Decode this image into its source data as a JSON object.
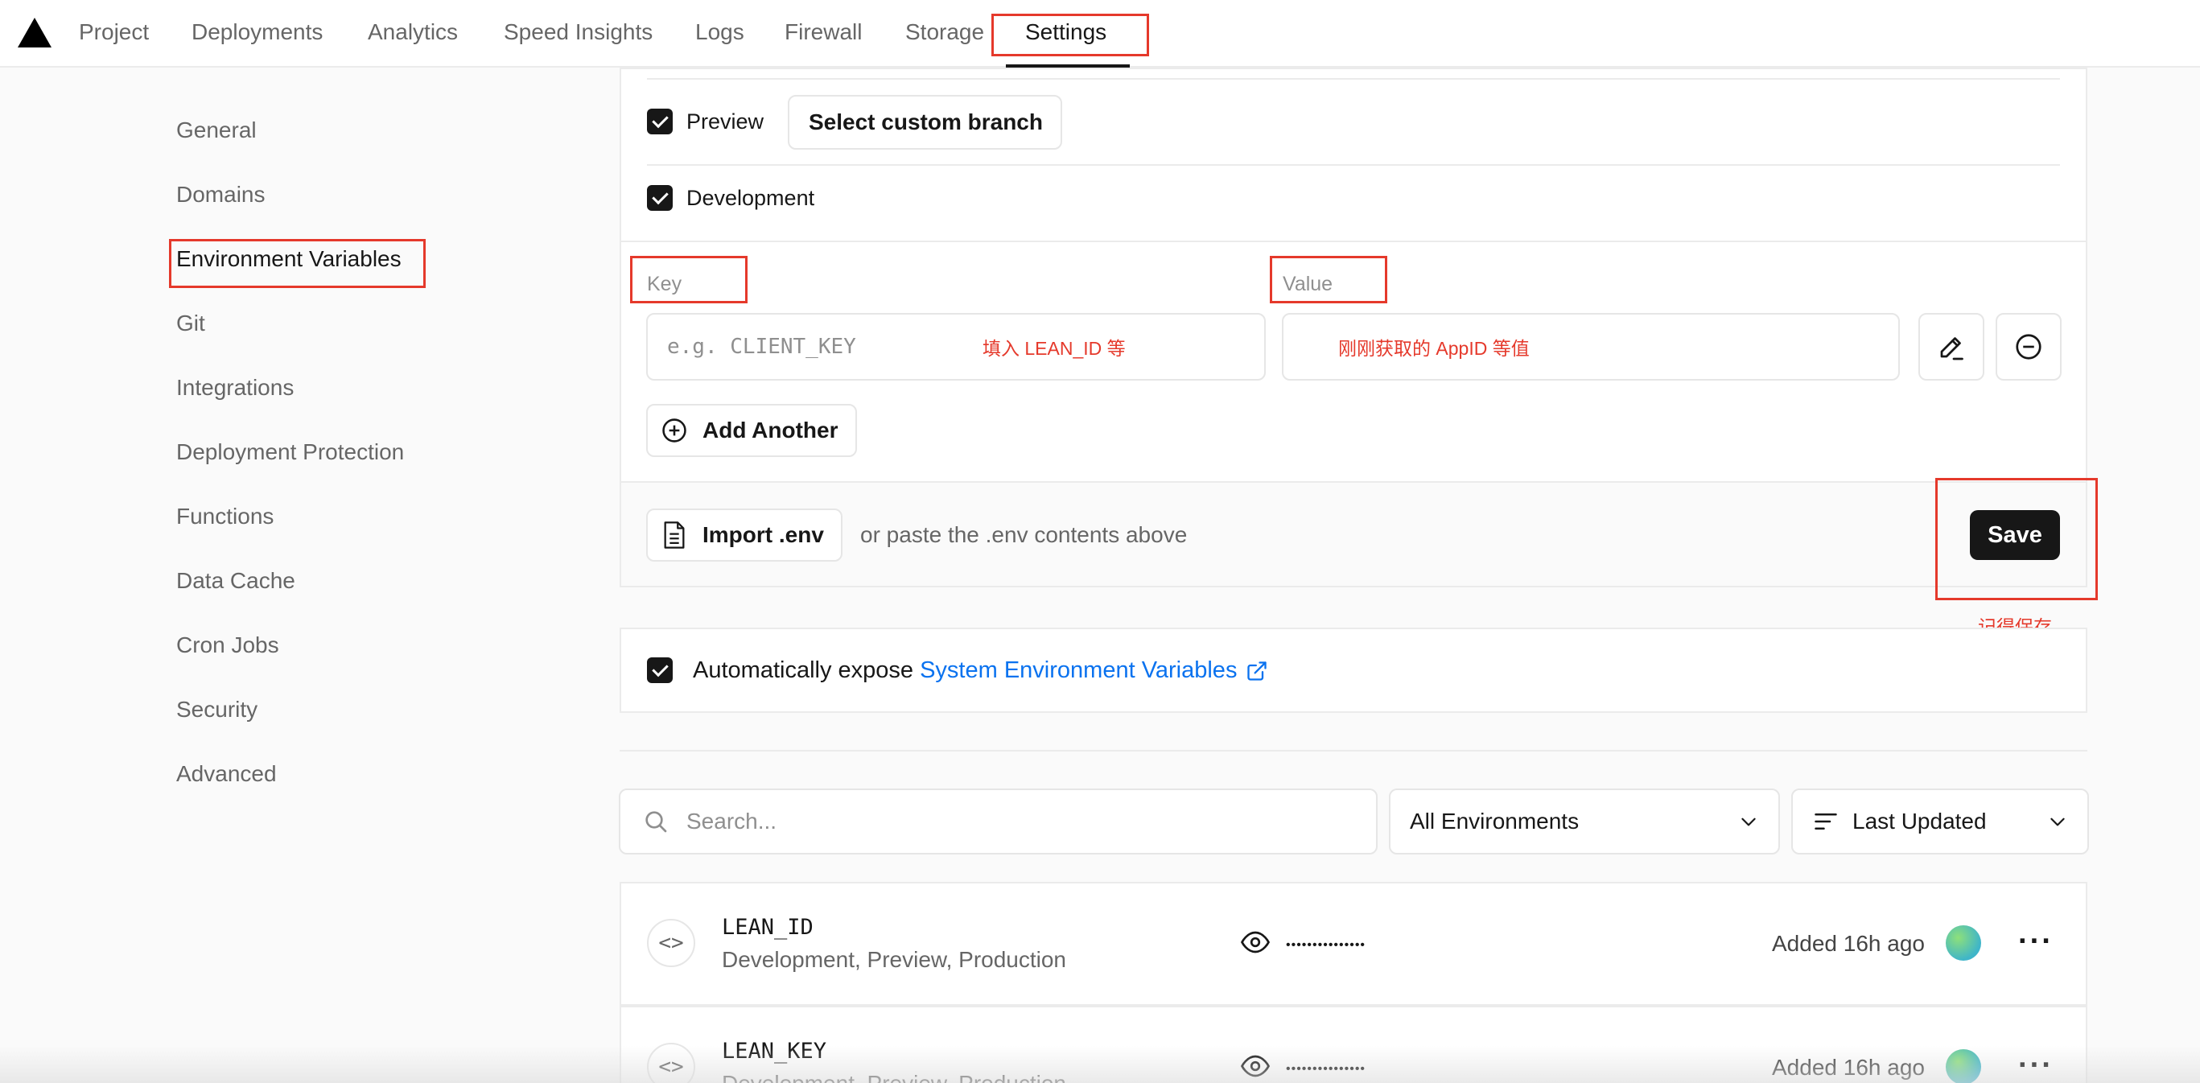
{
  "nav": {
    "tabs": [
      "Project",
      "Deployments",
      "Analytics",
      "Speed Insights",
      "Logs",
      "Firewall",
      "Storage",
      "Settings"
    ],
    "active_tab": "Settings"
  },
  "sidebar": {
    "items": [
      "General",
      "Domains",
      "Environment Variables",
      "Git",
      "Integrations",
      "Deployment Protection",
      "Functions",
      "Data Cache",
      "Cron Jobs",
      "Security",
      "Advanced"
    ],
    "active_item": "Environment Variables"
  },
  "env_form": {
    "preview_label": "Preview",
    "preview_checked": true,
    "custom_branch_button": "Select custom branch",
    "development_label": "Development",
    "development_checked": true,
    "key_label": "Key",
    "value_label": "Value",
    "key_placeholder": "e.g. CLIENT_KEY",
    "add_another_button": "Add Another",
    "import_button": "Import .env",
    "paste_hint": "or paste the .env contents above",
    "save_button": "Save"
  },
  "annotations": {
    "key_note": "填入 LEAN_ID 等",
    "value_note": "刚刚获取的 AppID 等值",
    "save_note": "记得保存"
  },
  "system_env": {
    "checked": true,
    "prefix": "Automatically expose ",
    "link_text": "System Environment Variables"
  },
  "filters": {
    "search_placeholder": "Search...",
    "environment_select": "All Environments",
    "sort_select": "Last Updated"
  },
  "variables": [
    {
      "name": "LEAN_ID",
      "environments": "Development, Preview, Production",
      "masked_value": "•••••••••••••••",
      "added": "Added 16h ago"
    },
    {
      "name": "LEAN_KEY",
      "environments": "Development, Preview, Production",
      "masked_value": "•••••••••••••••",
      "added": "Added 16h ago"
    }
  ],
  "colors": {
    "accent_link": "#0a72ef",
    "annotation_red": "#e5392b",
    "primary_button": "#171717"
  }
}
